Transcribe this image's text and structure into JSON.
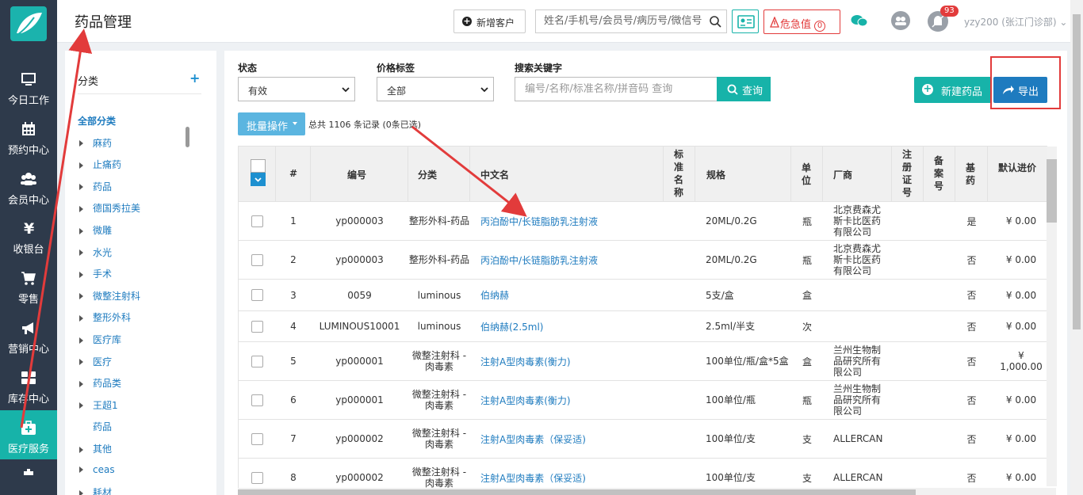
{
  "sidebar": {
    "items": [
      {
        "label": "今日工作",
        "icon": "monitor-icon"
      },
      {
        "label": "预约中心",
        "icon": "calendar-icon"
      },
      {
        "label": "会员中心",
        "icon": "users-icon"
      },
      {
        "label": "收银台",
        "icon": "yen-icon"
      },
      {
        "label": "零售",
        "icon": "cart-icon"
      },
      {
        "label": "营销中心",
        "icon": "megaphone-icon"
      },
      {
        "label": "库存中心",
        "icon": "grid-icon"
      },
      {
        "label": "医疗服务",
        "icon": "medical-kit-icon"
      }
    ],
    "active_index": 7
  },
  "header": {
    "title": "药品管理",
    "new_customer_label": "新增客户",
    "search_placeholder": "姓名/手机号/会员号/病历号/微信号",
    "critical_label": "危急值",
    "critical_count": "0",
    "notification_count": "93",
    "user_label": "yzy200 (张江门诊部)"
  },
  "categories": {
    "title": "分类",
    "add_label": "+",
    "items": [
      {
        "label": "全部分类",
        "root": true
      },
      {
        "label": "麻药"
      },
      {
        "label": "止痛药"
      },
      {
        "label": "药品"
      },
      {
        "label": "德国秀拉美"
      },
      {
        "label": "微雕"
      },
      {
        "label": "水光"
      },
      {
        "label": "手术"
      },
      {
        "label": "微整注射科"
      },
      {
        "label": "整形外科"
      },
      {
        "label": "医疗库"
      },
      {
        "label": "医疗"
      },
      {
        "label": "药品类"
      },
      {
        "label": "王超1"
      },
      {
        "label": "药品",
        "noarrow": true
      },
      {
        "label": "其他"
      },
      {
        "label": "ceas"
      },
      {
        "label": "耗材"
      }
    ]
  },
  "filters": {
    "status_label": "状态",
    "status_value": "有效",
    "price_label": "价格标签",
    "price_value": "全部",
    "keyword_label": "搜索关键字",
    "keyword_placeholder": "编号/名称/标准名称/拼音码 查询",
    "query_label": "查询",
    "new_drug_label": "新建药品",
    "export_label": "导出",
    "batch_label": "批量操作",
    "total_text": "总共 1106 条记录  (0条已选)"
  },
  "table": {
    "headers": {
      "num": "#",
      "code": "编号",
      "category": "分类",
      "name": "中文名",
      "std": "标准名称",
      "spec": "规格",
      "unit": "单位",
      "maker": "厂商",
      "reg": "注册证号",
      "record": "备案号",
      "base": "基药",
      "price": "默认进价"
    },
    "rows": [
      {
        "num": "1",
        "code": "yp000003",
        "category": "整形外科-药品",
        "name": "丙泊酚中/长链脂肪乳注射液",
        "spec": "20ML/0.2G",
        "unit": "瓶",
        "maker": "北京费森尤斯卡比医药有限公司",
        "base": "是",
        "price": "¥ 0.00"
      },
      {
        "num": "2",
        "code": "yp000003",
        "category": "整形外科-药品",
        "name": "丙泊酚中/长链脂肪乳注射液",
        "spec": "20ML/0.2G",
        "unit": "瓶",
        "maker": "北京费森尤斯卡比医药有限公司",
        "base": "否",
        "price": "¥ 0.00"
      },
      {
        "num": "3",
        "code": "0059",
        "category": "luminous",
        "name": "伯纳赫",
        "spec": "5支/盒",
        "unit": "盒",
        "maker": "",
        "base": "否",
        "price": "¥ 0.00"
      },
      {
        "num": "4",
        "code": "LUMINOUS10001",
        "category": "luminous",
        "name": "伯纳赫(2.5ml)",
        "spec": "2.5ml/半支",
        "unit": "次",
        "maker": "",
        "base": "否",
        "price": "¥ 0.00"
      },
      {
        "num": "5",
        "code": "yp000001",
        "category": "微整注射科 -肉毒素",
        "name": "注射A型肉毒素(衡力)",
        "spec": "100单位/瓶/盒*5盒",
        "unit": "盒",
        "maker": "兰州生物制品研究所有限公司",
        "base": "否",
        "price": "¥ 1,000.00"
      },
      {
        "num": "6",
        "code": "yp000001",
        "category": "微整注射科 -肉毒素",
        "name": "注射A型肉毒素(衡力)",
        "spec": "100单位/瓶",
        "unit": "瓶",
        "maker": "兰州生物制品研究所有限公司",
        "base": "否",
        "price": "¥ 0.00"
      },
      {
        "num": "7",
        "code": "yp000002",
        "category": "微整注射科 -肉毒素",
        "name": "注射A型肉毒素（保妥适)",
        "spec": "100单位/支",
        "unit": "支",
        "maker": "ALLERCAN",
        "base": "否",
        "price": "¥ 0.00"
      },
      {
        "num": "8",
        "code": "yp000002",
        "category": "微整注射科 -肉毒素",
        "name": "注射A型肉毒素（保妥适)",
        "spec": "100单位/支",
        "unit": "支",
        "maker": "ALLERCAN",
        "base": "否",
        "price": "¥ 0.00"
      }
    ]
  },
  "colors": {
    "sidebar": "#2e3a4b",
    "accent": "#17b3a9",
    "primary": "#1e7bbf",
    "annotation": "#e23b3b"
  }
}
